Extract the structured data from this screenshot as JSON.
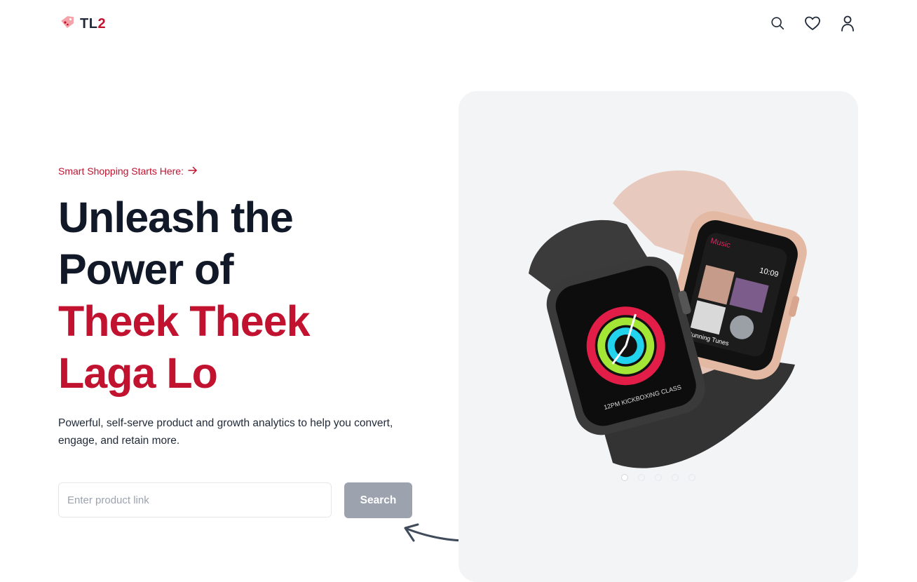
{
  "header": {
    "logo_main": "TL",
    "logo_accent": "2",
    "icons": [
      "search-icon",
      "heart-icon",
      "user-icon"
    ]
  },
  "hero": {
    "eyebrow": "Smart Shopping Starts Here:",
    "headline_lines": [
      "Unleash the",
      "Power of"
    ],
    "headline_highlight_lines": [
      "Theek Theek",
      "Laga Lo"
    ],
    "description": "Powerful, self-serve product and growth analytics to help you convert, engage, and retain more.",
    "search": {
      "placeholder": "Enter product link",
      "value": "",
      "button_label": "Search"
    }
  },
  "carousel": {
    "slide_count": 5,
    "active_index": 0,
    "watch_screen": {
      "app_label": "Music",
      "time": "10:09",
      "track": "Running Tunes",
      "workout": "12PM KICKBOXING CLASS"
    }
  },
  "colors": {
    "accent": "#c1122f",
    "heading": "#111827",
    "panel_bg": "#f3f4f6",
    "button_disabled": "#9ca3af"
  }
}
